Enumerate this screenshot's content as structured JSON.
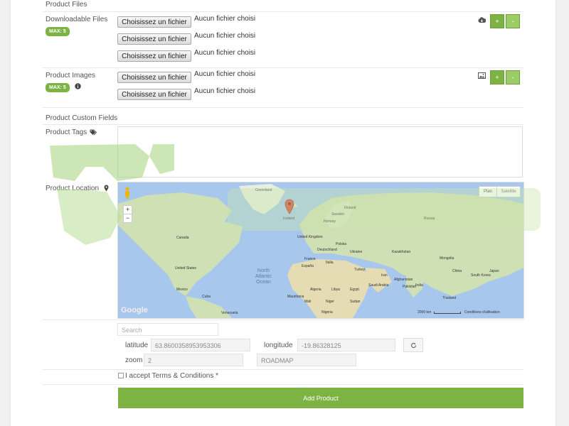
{
  "colors": {
    "accent": "#7cb342",
    "map_water": "#a7c7ec",
    "map_land": "#cfe0b4"
  },
  "sections": {
    "product_files": "Product Files",
    "custom_fields": "Product Custom Fields"
  },
  "downloadable": {
    "label": "Downloadable Files",
    "badge": "MAX: 5",
    "icon": "cloud-download-icon",
    "file_button": "Choisissez un fichier",
    "no_file": "Aucun fichier choisi",
    "add": "+",
    "remove": "-"
  },
  "images": {
    "label": "Product Images",
    "badge": "MAX: 5",
    "icon": "image-icon",
    "info_icon": "info-icon",
    "file_button": "Choisissez un fichier",
    "no_file": "Aucun fichier choisi",
    "add": "+",
    "remove": "-"
  },
  "tags": {
    "label": "Product Tags",
    "icon": "tags-icon"
  },
  "location": {
    "label": "Product Location",
    "icon": "map-marker-icon",
    "map": {
      "type_plan": "Plan",
      "type_satellite": "Satellite",
      "ocean_line1": "North",
      "ocean_line2": "Atlantic",
      "ocean_line3": "Ocean",
      "google": "Google",
      "scale": "2000 km",
      "terms": "Conditions d'utilisation",
      "zoom_in": "+",
      "zoom_out": "−",
      "places": {
        "greenland": "Greenland",
        "iceland": "Iceland",
        "norway": "Norway",
        "finland": "Finland",
        "sweden": "Sweden",
        "russia": "Russia",
        "kazakhstan": "Kazakhstan",
        "mongolia": "Mongolia",
        "china": "China",
        "india": "India",
        "canada": "Canada",
        "united_states": "United States",
        "mexico": "Mexico",
        "cuba": "Cuba",
        "venezuela": "Venezuela",
        "uk": "United Kingdom",
        "germany": "Deutschland",
        "poland": "Polska",
        "ukraine": "Ukraine",
        "france": "France",
        "spain": "España",
        "italy": "Italia",
        "turkey": "Turkey",
        "iran": "Iran",
        "afghanistan": "Afghanistan",
        "pakistan": "Pakistan",
        "algeria": "Algeria",
        "libya": "Libya",
        "egypt": "Egypt",
        "mali": "Mali",
        "niger": "Niger",
        "nigeria": "Nigeria",
        "sudan": "Sudan",
        "saudi": "Saudi Arabia",
        "japan": "Japan",
        "south_korea": "South Korea",
        "thailand": "Thailand",
        "mauritania": "Mauritania"
      }
    },
    "search_placeholder": "Search",
    "latitude_label": "latitude",
    "latitude_value": "63.8600358953953306",
    "longitude_label": "longitude",
    "longitude_value": "-19.86328125",
    "zoom_label": "zoom",
    "zoom_value": "2",
    "maptype_value": "ROADMAP",
    "refresh_icon": "refresh-icon"
  },
  "terms": {
    "label": "I accept Terms & Conditions *"
  },
  "submit": {
    "label": "Add Product"
  }
}
